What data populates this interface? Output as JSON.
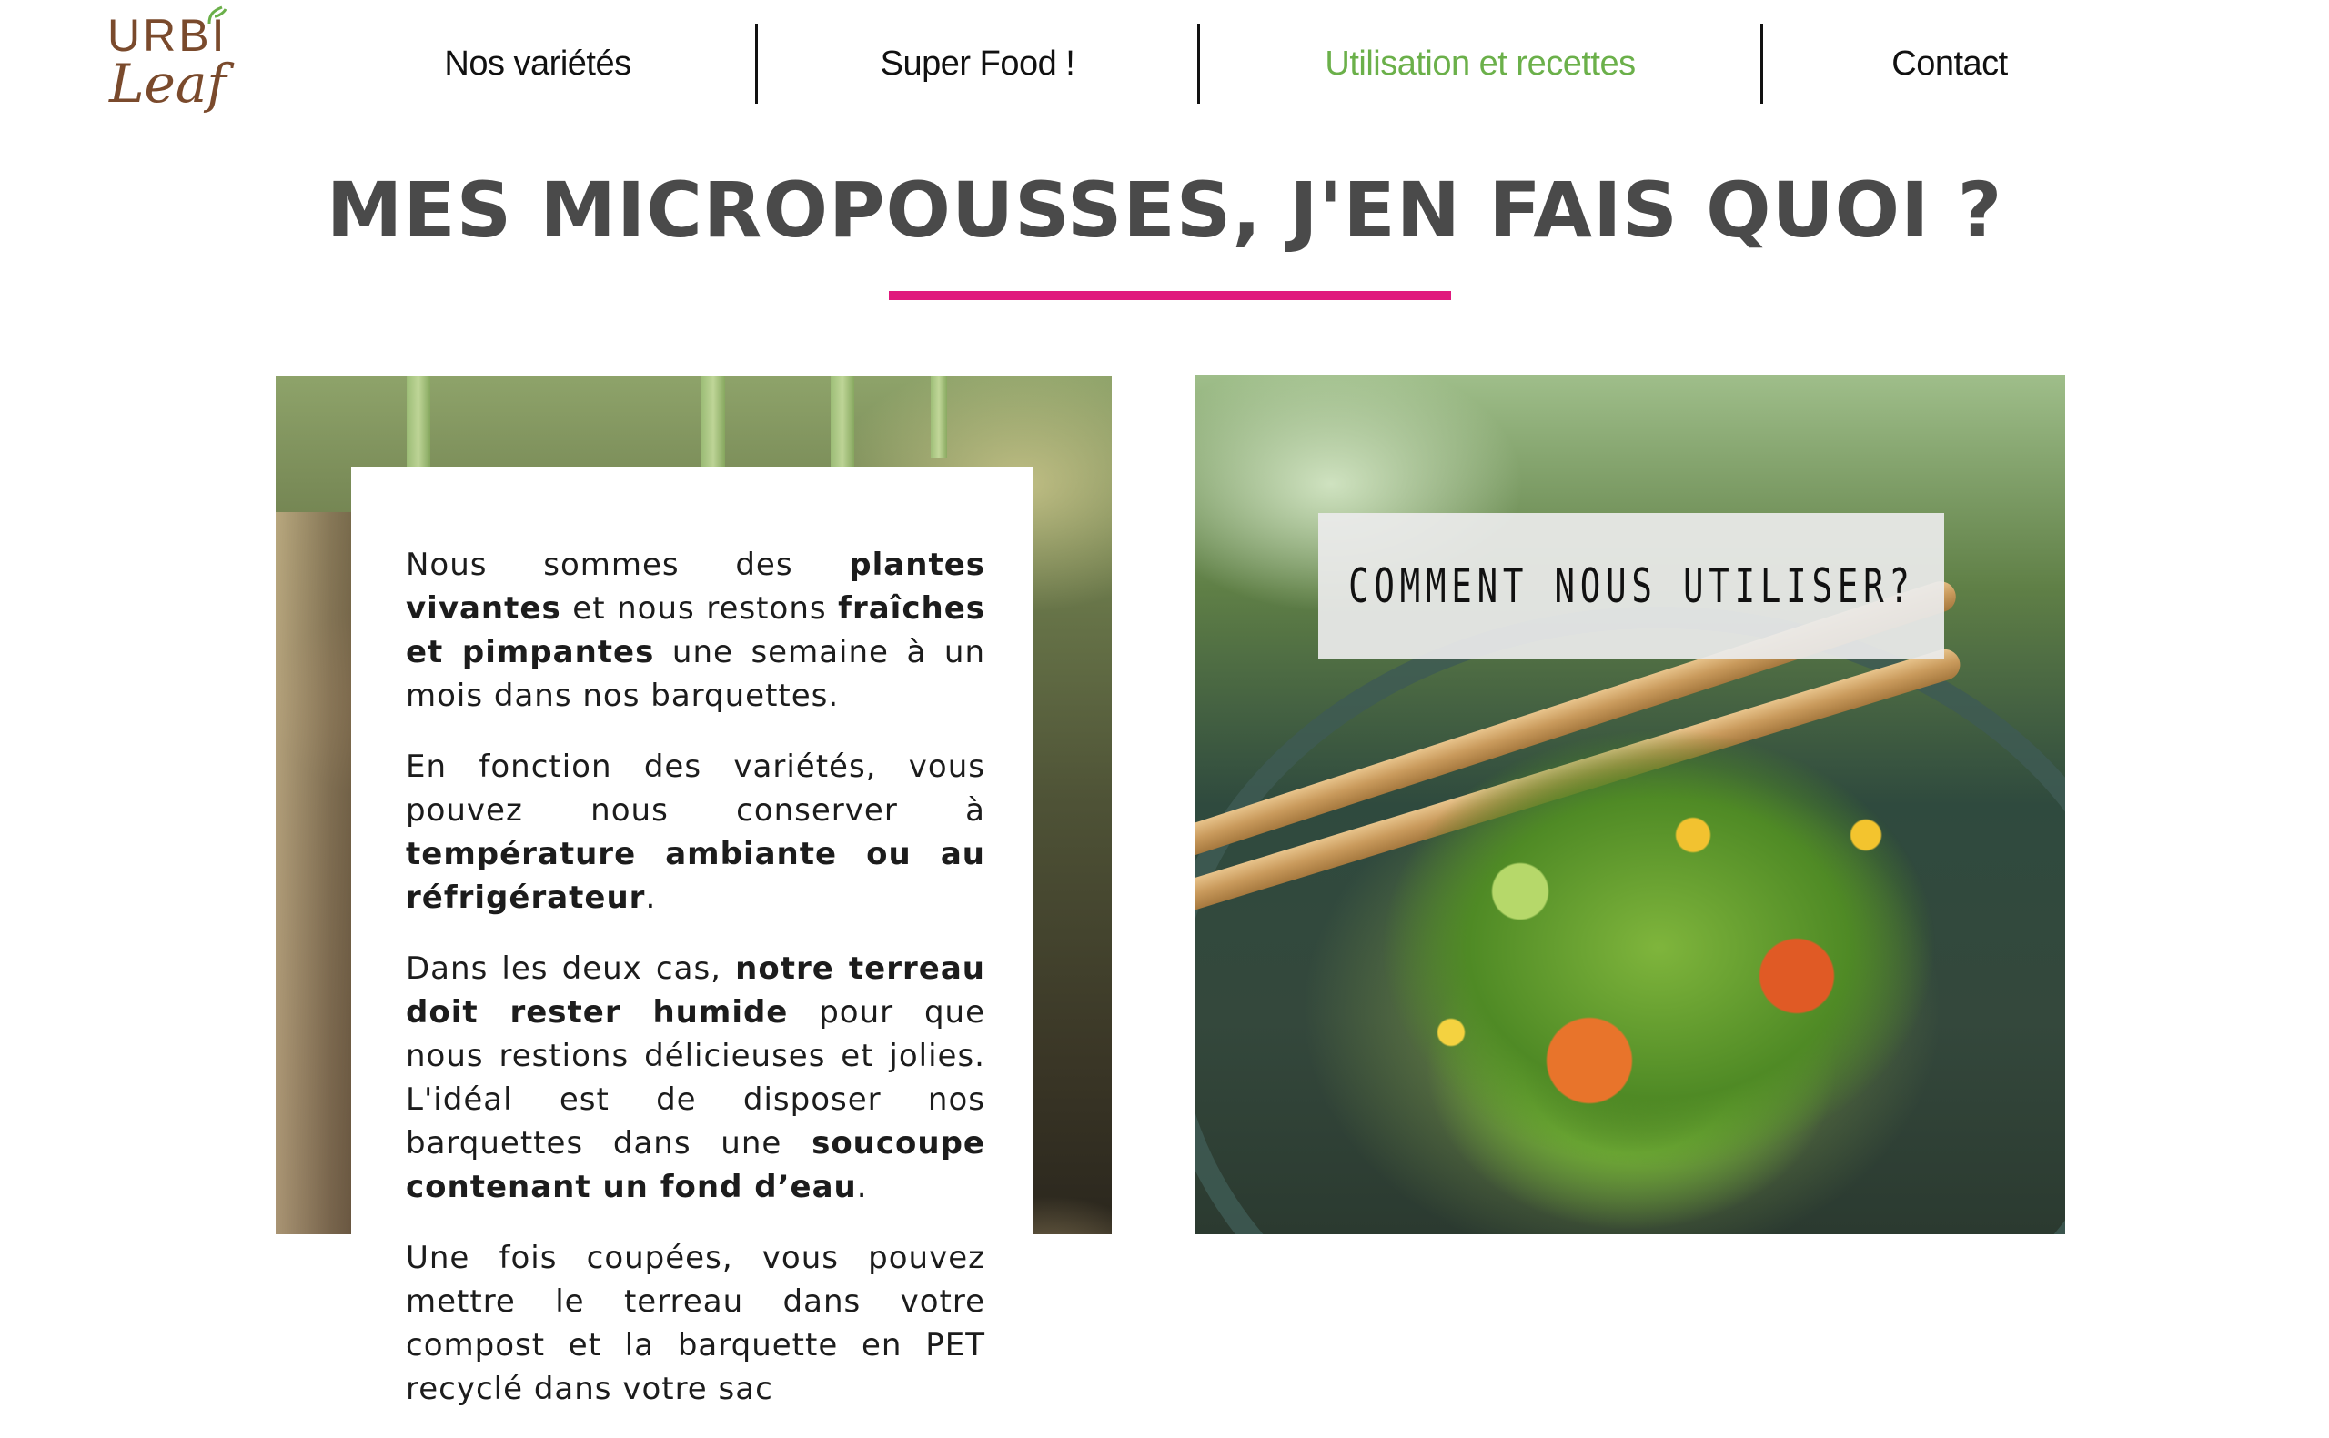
{
  "logo": {
    "text_top": "URBI",
    "text_bottom": "Leaf"
  },
  "nav": {
    "items": [
      {
        "label": "Nos variétés",
        "active": false
      },
      {
        "label": "Super Food !",
        "active": false
      },
      {
        "label": "Utilisation et recettes",
        "active": true
      },
      {
        "label": "Contact",
        "active": false
      }
    ],
    "active_color": "#6bb04a"
  },
  "page": {
    "title": "MES MICROPOUSSES, J'EN FAIS QUOI ?",
    "underline_color": "#e0197d"
  },
  "text_card": {
    "p1": {
      "a": "Nous sommes des ",
      "b1": "plantes vivantes",
      "c": " et nous restons ",
      "b2": "fraîches et pimpantes",
      "d": " une semaine à un mois dans nos barquettes."
    },
    "p2": {
      "a": "En fonction des variétés, vous pouvez nous conserver à ",
      "b1": "température ambiante ou au réfrigérateur",
      "c": "."
    },
    "p3": {
      "a": "Dans les deux cas, ",
      "b1": "notre terreau doit rester humide",
      "c": " pour que nous restions délicieuses et jolies. L'idéal est de disposer nos barquettes dans une ",
      "b2": "soucoupe contenant un fond d’eau",
      "d": "."
    },
    "p4": {
      "a": "Une fois coupées, vous pouvez mettre le terreau dans votre compost et la barquette en PET recyclé dans votre sac"
    }
  },
  "recipe_banner": {
    "label": "COMMENT NOUS UTILISER?"
  }
}
